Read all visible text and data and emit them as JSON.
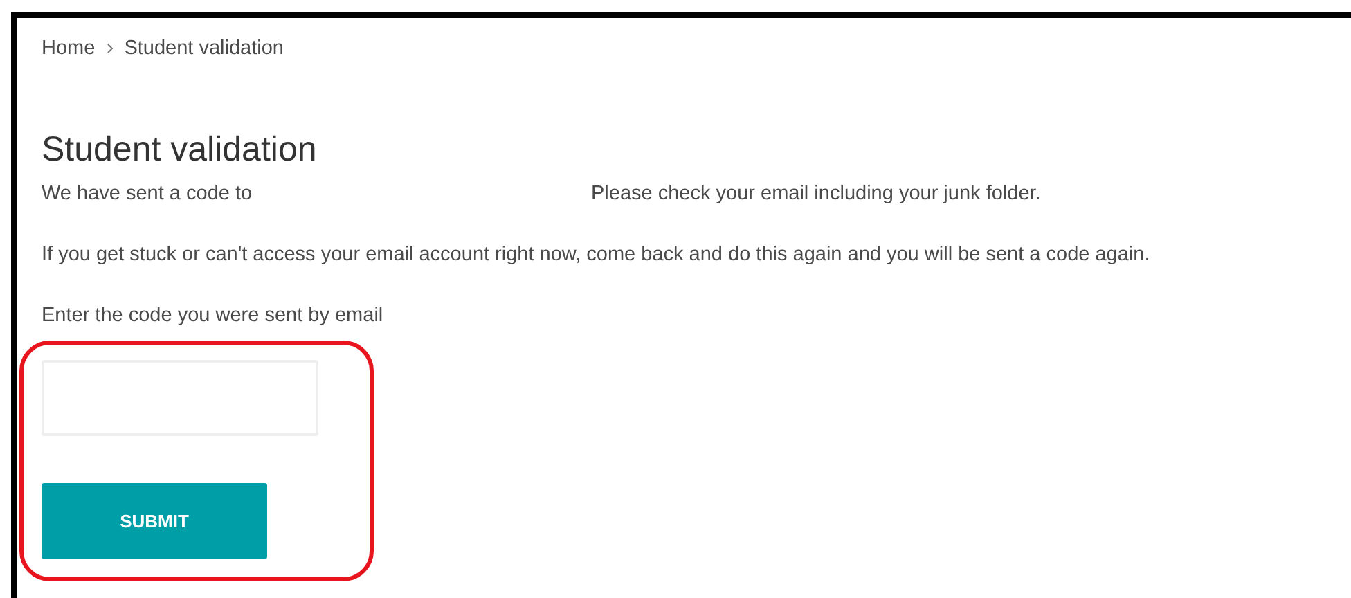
{
  "breadcrumb": [
    {
      "label": "Home"
    },
    {
      "label": "Student validation"
    }
  ],
  "title": "Student validation",
  "sent_line": {
    "before": "We have sent a code to",
    "after": "Please check your email including your junk folder."
  },
  "help_text": "If you get stuck or can't access your email account right now, come back and do this again and you will be sent a code again.",
  "code_label": "Enter the code you were sent by email",
  "submit_button": "SUBMIT"
}
